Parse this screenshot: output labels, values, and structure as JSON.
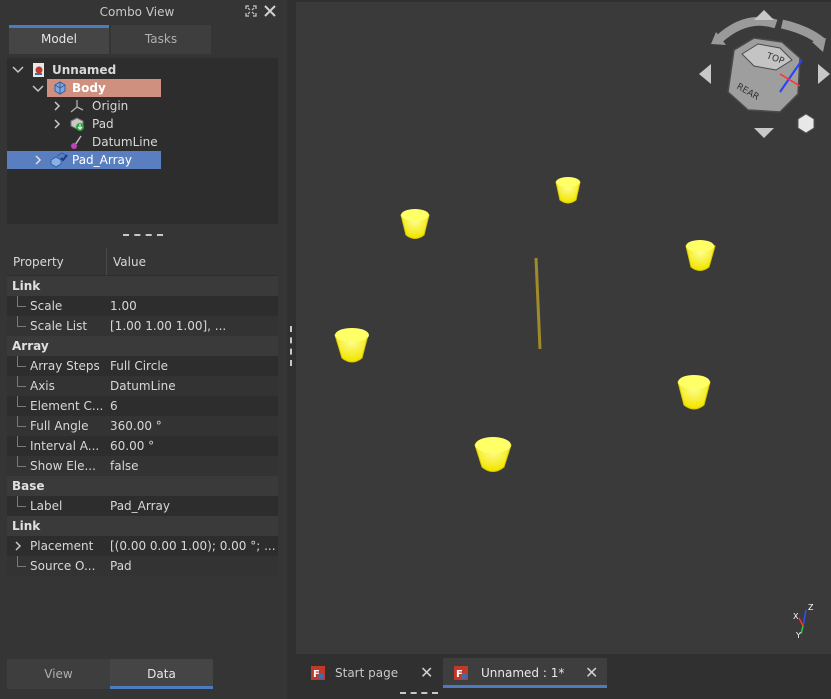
{
  "combo_view": {
    "title": "Combo View",
    "tabs": [
      "Model",
      "Tasks"
    ]
  },
  "tree": [
    {
      "label": "Unnamed"
    },
    {
      "label": "Body"
    },
    {
      "label": "Origin"
    },
    {
      "label": "Pad"
    },
    {
      "label": "DatumLine"
    },
    {
      "label": "Pad_Array"
    }
  ],
  "properties": {
    "headers": [
      "Property",
      "Value"
    ],
    "rows": [
      {
        "group": "Link"
      },
      {
        "key": "Scale",
        "value": "1.00"
      },
      {
        "key": "Scale List",
        "value": "[1.00 1.00 1.00], ..."
      },
      {
        "group": "Array"
      },
      {
        "key": "Array Steps",
        "value": "Full Circle"
      },
      {
        "key": "Axis",
        "value": "DatumLine"
      },
      {
        "key": "Element C...",
        "value": "6"
      },
      {
        "key": "Full Angle",
        "value": "360.00 °"
      },
      {
        "key": "Interval A...",
        "value": "60.00 °"
      },
      {
        "key": "Show Ele...",
        "value": "false"
      },
      {
        "group": "Base"
      },
      {
        "key": "Label",
        "value": "Pad_Array"
      },
      {
        "group": "Link"
      },
      {
        "key": "Placement",
        "value": "[(0.00 0.00 1.00); 0.00 °; ..."
      },
      {
        "key": "Source O...",
        "value": "Pad"
      }
    ]
  },
  "bottom_tabs": [
    "View",
    "Data"
  ],
  "document_tabs": [
    {
      "label": "Start page"
    },
    {
      "label": "Unnamed : 1*"
    }
  ],
  "nav_cube": {
    "top_face": "TOP",
    "front_face": "REAR"
  },
  "axis_labels": {
    "x": "X",
    "y": "Y",
    "z": "Z"
  },
  "colors": {
    "selection_orange": "#d09080",
    "selection_blue": "#5a7fc0",
    "object_yellow": "#ffff33",
    "datum_line": "#a08a2a"
  }
}
